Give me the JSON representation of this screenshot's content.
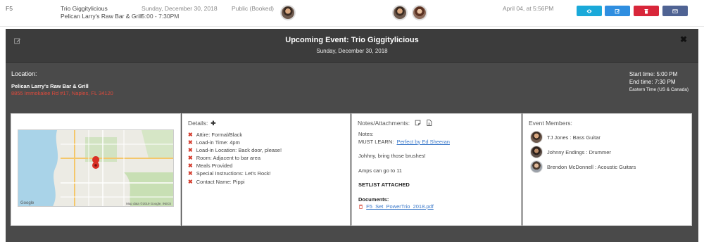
{
  "row": {
    "id": "F5",
    "event_title": "Trio Giggitylicious",
    "venue": "Pelican Larry's Raw Bar & Grill",
    "date": "Sunday, December 30, 2018",
    "time": "5:00 - 7:30PM",
    "status": "Public (Booked)",
    "created": "April 04, at 5:56PM",
    "buttons": [
      {
        "name": "view",
        "icon": "eye-icon",
        "color": "#1aa9d9"
      },
      {
        "name": "edit",
        "icon": "edit-icon",
        "color": "#2f8ee0"
      },
      {
        "name": "delete",
        "icon": "trash-icon",
        "color": "#d8263a"
      },
      {
        "name": "email",
        "icon": "envelope-icon",
        "color": "#4f6393"
      }
    ]
  },
  "modal": {
    "title": "Upcoming Event: Trio Giggitylicious",
    "subtitle": "Sunday, December 30, 2018",
    "location_label": "Location:",
    "venue_name": "Pelican Larry's Raw Bar & Grill",
    "venue_address": "8855 Immokalee Rd #17, Naples, FL 34120",
    "start_time": "Start time: 5:00 PM",
    "end_time": "End time: 7:30 PM",
    "timezone": "Eastern Time (US & Canada)"
  },
  "details": {
    "title": "Details:",
    "items": [
      "Attire: Formal/Black",
      "Load-in Time: 4pm",
      "Load-in Location: Back door, please!",
      "Room: Adjacent to bar area",
      "Meals Provided",
      "Special Instructions: Let's Rock!",
      "Contact Name: Pippi"
    ]
  },
  "notes": {
    "title": "Notes/Attachments:",
    "label": "Notes:",
    "must_learn_prefix": "MUST LEARN:",
    "must_learn_link": "Perfect by Ed Sheeran",
    "line2": "Johhny, bring those brushes!",
    "line3": "Amps can go to 11",
    "setlist": "SETLIST ATTACHED",
    "documents_label": "Documents:",
    "document_file": "F5_Set_PowerTrio_2018.pdf"
  },
  "members": {
    "title": "Event Members:",
    "list": [
      "TJ Jones : Bass Guitar",
      "Johnny Endings : Drummer",
      "Brendon McDonnell : Acoustic Guitars"
    ]
  },
  "map": {
    "attribution": "Map data ©2019 Google, INEGI",
    "google_logo": "Google"
  },
  "colors": {
    "modal_bg": "#4a4a4a",
    "header_bg": "#3c3c3c",
    "address_red": "#e04a3c",
    "x_red": "#d43b2c",
    "link_blue": "#3a78c9"
  }
}
